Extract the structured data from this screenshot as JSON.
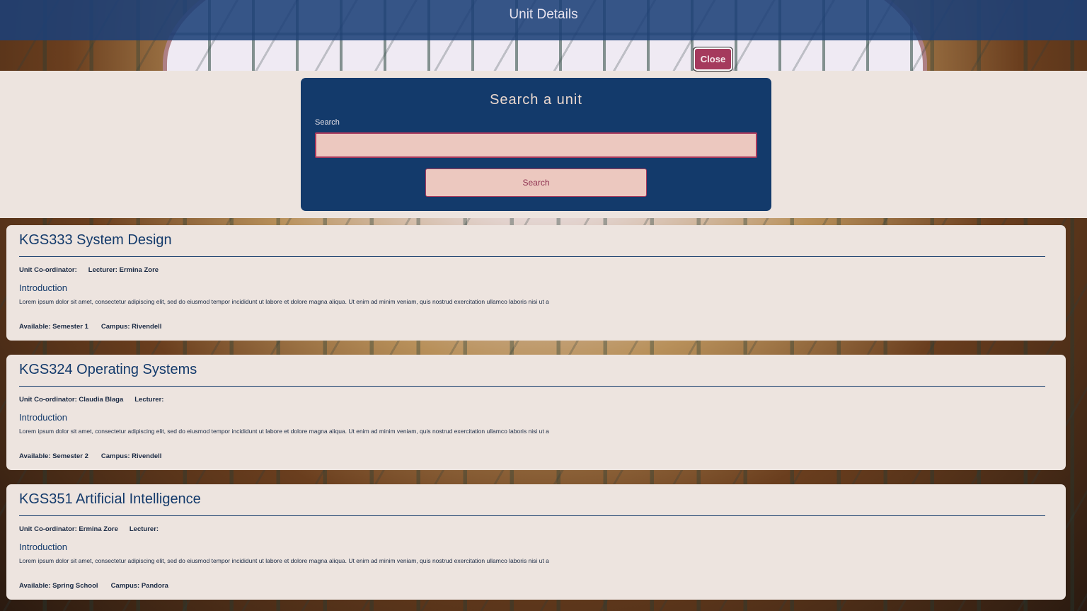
{
  "header": {
    "title": "Unit Details",
    "close_label": "Close"
  },
  "search": {
    "title": "Search a unit",
    "label": "Search",
    "value": "",
    "placeholder": "",
    "button_label": "Search"
  },
  "units": [
    {
      "title": "KGS333 System Design",
      "coordinator": "Unit Co-ordinator:",
      "lecturer": "Lecturer: Ermina Zore",
      "intro_heading": "Introduction",
      "intro_text": "Lorem ipsum dolor sit amet, consectetur adipiscing elit, sed do eiusmod tempor incididunt ut labore et dolore magna aliqua. Ut enim ad minim veniam, quis nostrud exercitation ullamco laboris nisi ut a",
      "available": "Available: Semester 1",
      "campus": "Campus: Rivendell"
    },
    {
      "title": "KGS324 Operating Systems",
      "coordinator": "Unit Co-ordinator: Claudia Blaga",
      "lecturer": "Lecturer:",
      "intro_heading": "Introduction",
      "intro_text": "Lorem ipsum dolor sit amet, consectetur adipiscing elit, sed do eiusmod tempor incididunt ut labore et dolore magna aliqua. Ut enim ad minim veniam, quis nostrud exercitation ullamco laboris nisi ut a",
      "available": "Available: Semester 2",
      "campus": "Campus: Rivendell"
    },
    {
      "title": "KGS351 Artificial Intelligence",
      "coordinator": "Unit Co-ordinator: Ermina Zore",
      "lecturer": "Lecturer:",
      "intro_heading": "Introduction",
      "intro_text": "Lorem ipsum dolor sit amet, consectetur adipiscing elit, sed do eiusmod tempor incididunt ut labore et dolore magna aliqua. Ut enim ad minim veniam, quis nostrud exercitation ullamco laboris nisi ut a",
      "available": "Available: Spring School",
      "campus": "Campus: Pandora"
    }
  ],
  "colors": {
    "header_bg": "#1c4078",
    "card_bg": "#ede4df",
    "search_card_bg": "#133a6b",
    "accent": "#a53a5d",
    "input_bg": "#ecc8bf"
  }
}
